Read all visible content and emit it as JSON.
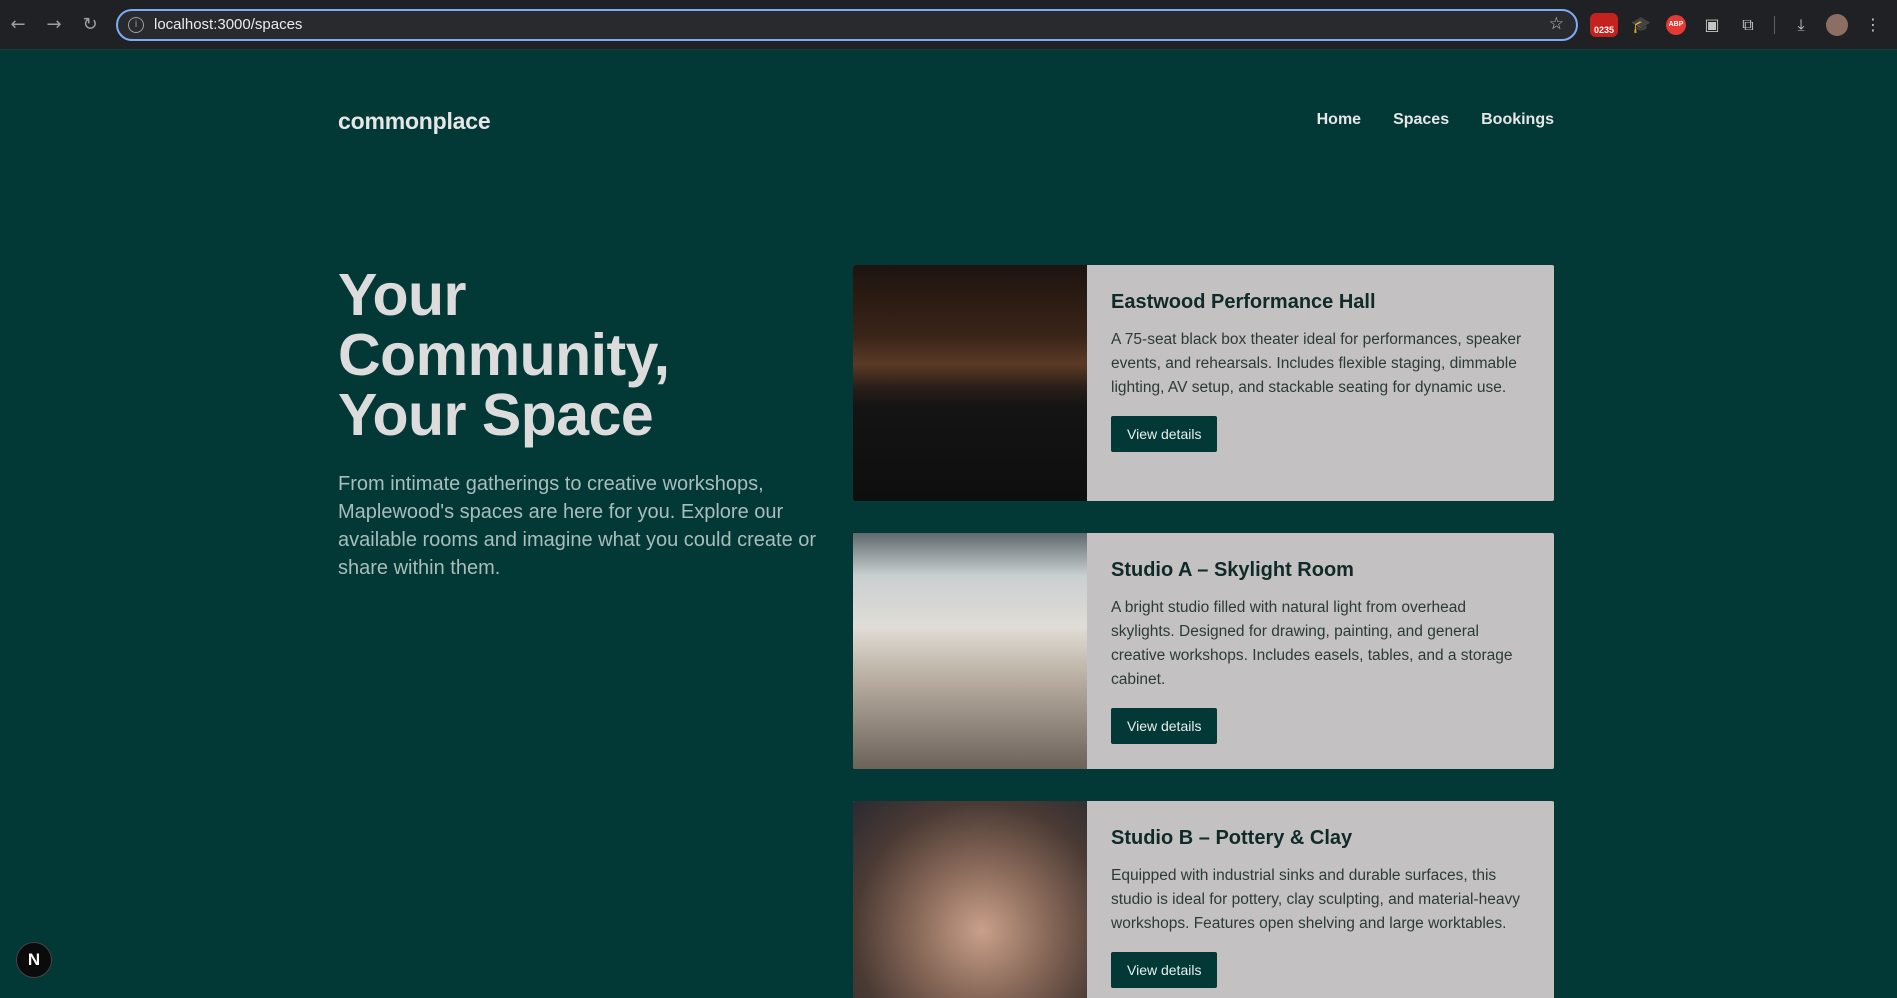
{
  "browser": {
    "url": "localhost:3000/spaces",
    "back_icon": "←",
    "forward_icon": "→",
    "reload_icon": "↻",
    "info_icon": "i",
    "star_icon": "☆",
    "extension_badge_text": "0235",
    "extension_grad_icon": "🎓",
    "extension_abp_text": "ABP",
    "extension_reader_icon": "▣",
    "extensions_icon": "⧉",
    "download_icon": "⤓",
    "menu_icon": "⋮"
  },
  "header": {
    "logo": "commonplace",
    "nav": [
      "Home",
      "Spaces",
      "Bookings"
    ]
  },
  "hero": {
    "title_lines": [
      "Your",
      "Community,",
      "Your Space"
    ],
    "subtitle": "From intimate gatherings to creative workshops, Maplewood's spaces are here for you. Explore our available rooms and imagine what you could create or share within them."
  },
  "spaces": [
    {
      "title": "Eastwood Performance Hall",
      "description": "A 75-seat black box theater ideal for performances, speaker events, and rehearsals. Includes flexible staging, dimmable lighting, AV setup, and stackable seating for dynamic use.",
      "button": "View details"
    },
    {
      "title": "Studio A – Skylight Room",
      "description": "A bright studio filled with natural light from overhead skylights. Designed for drawing, painting, and general creative workshops. Includes easels, tables, and a storage cabinet.",
      "button": "View details"
    },
    {
      "title": "Studio B – Pottery & Clay",
      "description": "Equipped with industrial sinks and durable surfaces, this studio is ideal for pottery, clay sculpting, and material-heavy workshops. Features open shelving and large worktables.",
      "button": "View details"
    }
  ],
  "next_badge": "N"
}
